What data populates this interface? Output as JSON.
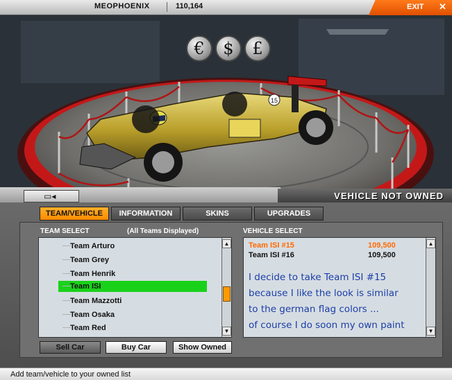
{
  "topbar": {
    "player_name": "MEOPHOENIX",
    "money": "110,164",
    "exit_label": "EXIT",
    "close_glyph": "✕"
  },
  "currency_buttons": [
    {
      "symbol": "€",
      "icon": "euro-icon"
    },
    {
      "symbol": "$",
      "icon": "dollar-icon"
    },
    {
      "symbol": "£",
      "icon": "pound-icon"
    }
  ],
  "car": {
    "number": "15"
  },
  "back_button": {
    "icon": "back-arrow-icon",
    "glyph": "▭◂"
  },
  "vehicle_status": "VEHICLE NOT OWNED",
  "tabs": [
    {
      "label": "TEAM/VEHICLE",
      "active": true
    },
    {
      "label": "INFORMATION",
      "active": false
    },
    {
      "label": "SKINS",
      "active": false
    },
    {
      "label": "UPGRADES",
      "active": false
    }
  ],
  "team_select": {
    "header": "TEAM SELECT",
    "filter_note": "(All Teams Displayed)",
    "teams": [
      "Team Arturo",
      "Team Grey",
      "Team Henrik",
      "Team ISI",
      "Team Mazzotti",
      "Team Osaka",
      "Team Red"
    ],
    "selected": "Team ISI"
  },
  "vehicle_select": {
    "header": "VEHICLE SELECT",
    "vehicles": [
      {
        "name": "Team ISI #15",
        "price": "109,500",
        "selected": true
      },
      {
        "name": "Team ISI #16",
        "price": "109,500",
        "selected": false
      }
    ]
  },
  "annotation": [
    "I decide to take Team ISI #15",
    "because I like the look is similar",
    "to the german flag colors ...",
    "of course I do soon my own paint"
  ],
  "scroll": {
    "up": "▲",
    "down": "▼"
  },
  "buttons": {
    "sell": "Sell Car",
    "buy": "Buy Car",
    "show_owned": "Show Owned"
  },
  "status_bar": "Add team/vehicle to your owned list",
  "colors": {
    "accent": "#ff8a00",
    "selected_row": "#1ad11a",
    "selected_vehicle": "#ff6a00",
    "annotation": "#1c3ea8"
  }
}
